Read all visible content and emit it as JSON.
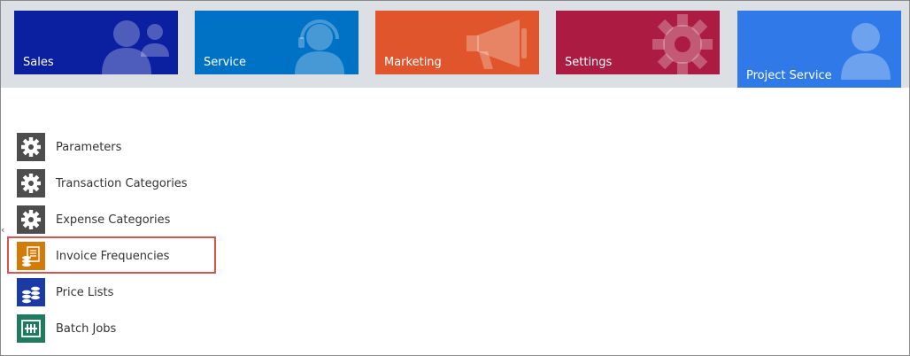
{
  "tiles": [
    {
      "label": "Sales",
      "icon": "people-icon",
      "color": "#0b1fa1"
    },
    {
      "label": "Service",
      "icon": "headset-agent-icon",
      "color": "#0072c6"
    },
    {
      "label": "Marketing",
      "icon": "megaphone-icon",
      "color": "#e0552c"
    },
    {
      "label": "Settings",
      "icon": "gear-icon",
      "color": "#ac1b41"
    },
    {
      "label": "Project Service",
      "icon": "person-icon",
      "color": "#2f7ae8"
    }
  ],
  "nav": {
    "collapse_glyph": "‹",
    "items": [
      {
        "label": "Parameters",
        "icon": "gear-icon"
      },
      {
        "label": "Transaction Categories",
        "icon": "gear-icon"
      },
      {
        "label": "Expense Categories",
        "icon": "gear-icon"
      },
      {
        "label": "Invoice Frequencies",
        "icon": "invoice-icon"
      },
      {
        "label": "Price Lists",
        "icon": "price-list-icon"
      },
      {
        "label": "Batch Jobs",
        "icon": "batch-jobs-icon"
      }
    ]
  },
  "colors": {
    "highlight_border": "#d9534f",
    "tilebar_bg": "#dcdfe4"
  }
}
